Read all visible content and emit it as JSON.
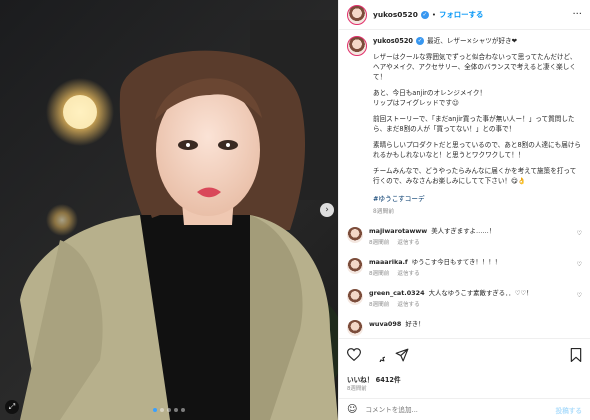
{
  "post": {
    "username": "yukos0520",
    "follow_label": "フォローする",
    "separator": "•",
    "more_label": "···"
  },
  "caption": {
    "username": "yukos0520",
    "title": "最近、レザー×シャツが好き❤",
    "paragraphs": [
      "レザーはクールな雰囲気でずっと似合わないって思ってたんだけど、ヘアやメイク、アクセサリー、全体のバランスで考えると凄く楽しくて！",
      "あと、今日もanjirのオレンジメイク！\nリップはフイグレッドです😉",
      "前回ストーリーで、「まだanjir買った事が無い人ー！」って質問したら、まだ8割の人が「買ってない！」との事で！",
      "素晴らしいプロダクトだと思っているので、あと8割の人達にも届けられるかもしれないなと！と思うとワクワクして！！",
      "チームみんなで、どうやったらみんなに届くかを考えて施策を打って行くので、みなさんお楽しみにしてて下さい！😋👌"
    ],
    "hashtag": "#ゆうこすコーデ",
    "time": "8週間前"
  },
  "comments": [
    {
      "username": "majiwarotawww",
      "text": "美人すぎますよ……！",
      "time": "8週間前",
      "reply": "返信する"
    },
    {
      "username": "maaarika.f",
      "text": "ゆうこす今日もすてき！！！！",
      "time": "8週間前",
      "reply": "返信する"
    },
    {
      "username": "green_cat.0324",
      "text": "大人なゆうこす素敵すぎる．．♡♡！",
      "time": "8週間前",
      "reply": "返信する"
    },
    {
      "username": "wuva098",
      "text": "好き！",
      "time": "",
      "reply": ""
    }
  ],
  "stats": {
    "likes_label": "いいね！",
    "likes_count": "6412件",
    "date": "8週間前"
  },
  "comment_input": {
    "placeholder": "コメントを追加...",
    "post_label": "投稿する"
  },
  "photo": {
    "next_glyph": "›",
    "slides": 5,
    "active_slide": 1
  }
}
